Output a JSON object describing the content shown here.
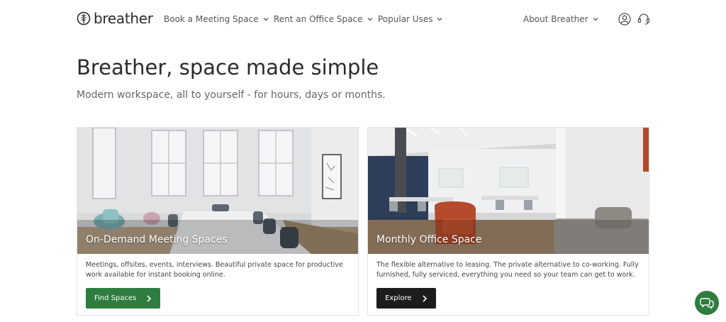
{
  "header": {
    "logo_text": "breather",
    "nav": [
      {
        "label": "Book a Meeting Space"
      },
      {
        "label": "Rent an Office Space"
      },
      {
        "label": "Popular Uses"
      },
      {
        "label": "About Breather"
      }
    ],
    "icons": [
      "user-account-icon",
      "headset-support-icon",
      "chevron-down-icon"
    ]
  },
  "hero": {
    "title": "Breather, space made simple",
    "subtitle": "Modern workspace, all to yourself - for hours, days or months."
  },
  "cards": [
    {
      "title": "On-Demand Meeting Spaces",
      "description": "Meetings, offsites, events, interviews. Beautiful private space for productive work available for instant booking online.",
      "button_label": "Find Spaces"
    },
    {
      "title": "Monthly Office Space",
      "description": "The flexible alternative to leasing. The private alternative to co-working. Fully furnished, fully serviced, everything you need so your team can get to work.",
      "button_label": "Explore"
    }
  ],
  "colors": {
    "brand_green": "#2e7d3f",
    "dark_button": "#1c1c1c"
  },
  "chat": {
    "icon": "chat-bubbles-icon"
  }
}
